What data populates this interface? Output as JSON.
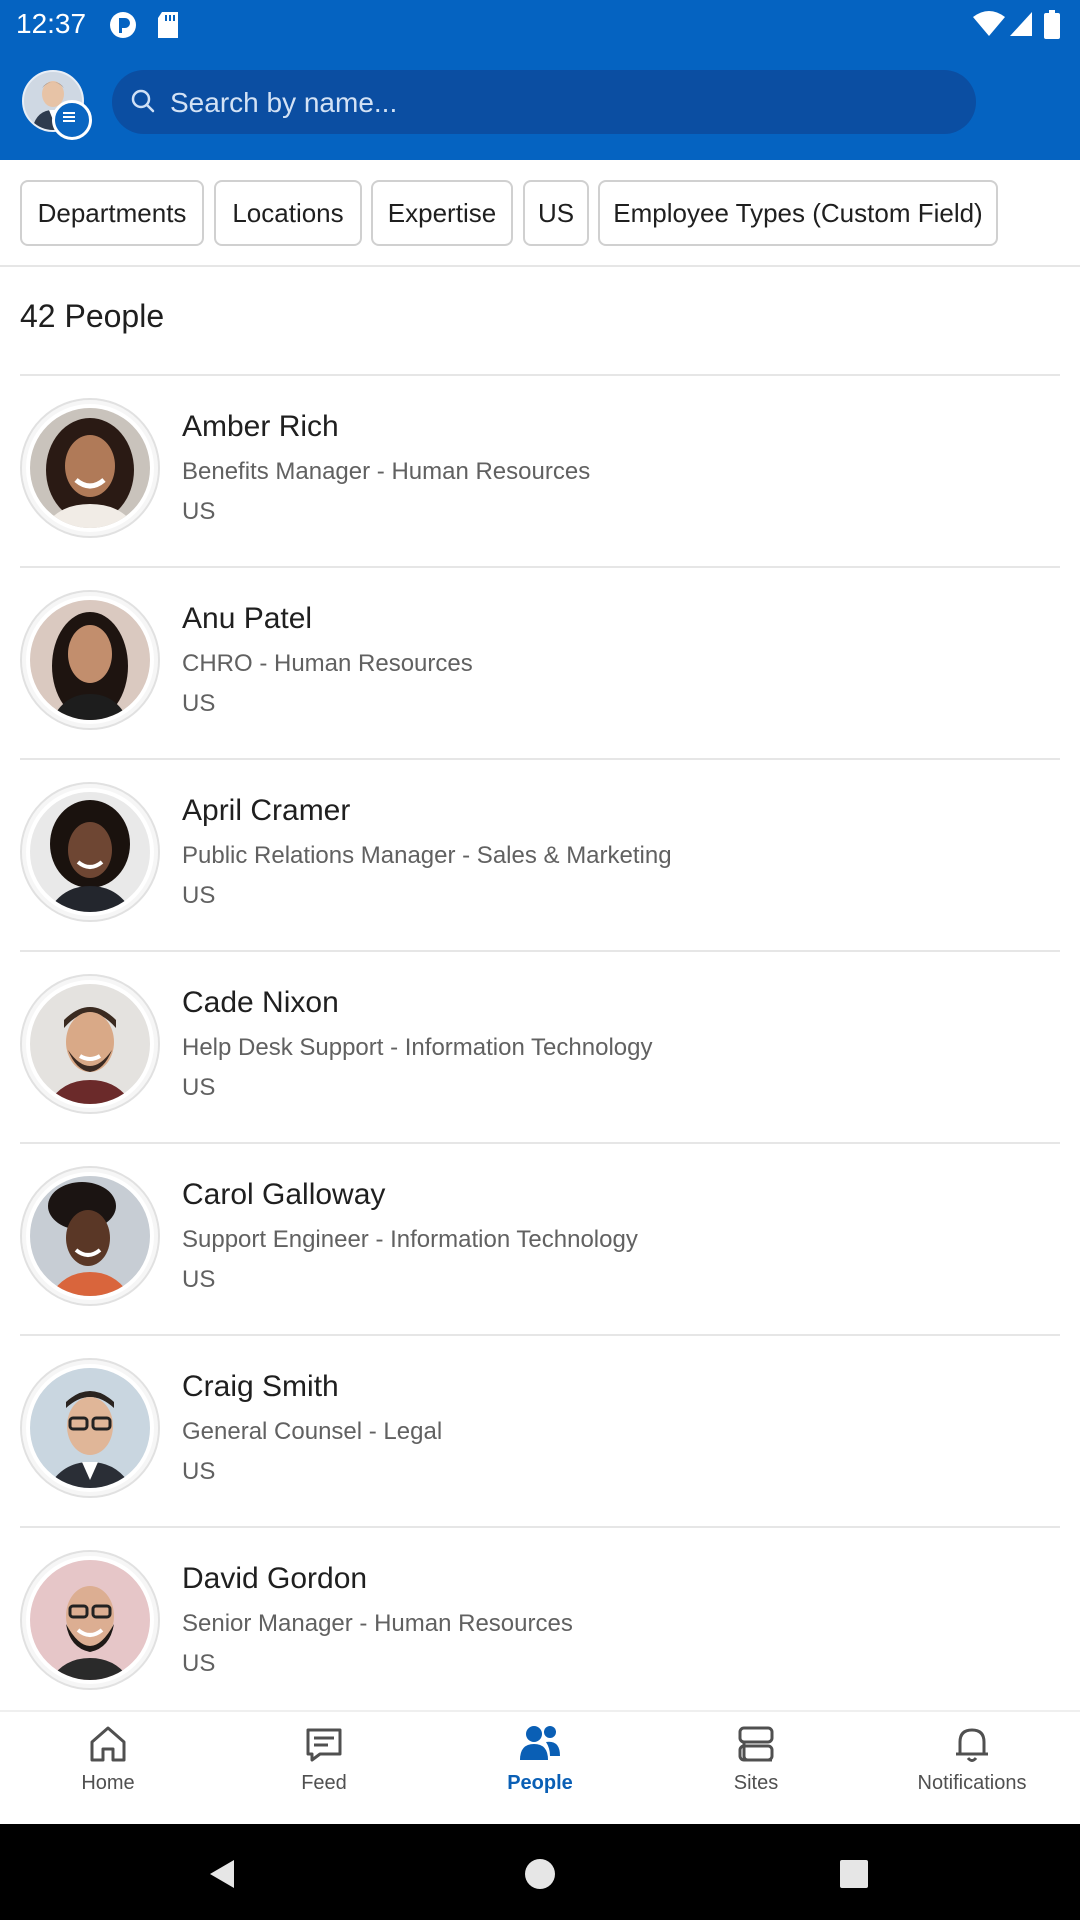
{
  "status_bar": {
    "time": "12:37",
    "icons": [
      "notification-p-icon",
      "sd-card-icon",
      "wifi-icon",
      "signal-icon",
      "battery-icon"
    ]
  },
  "header": {
    "search_placeholder": "Search by name..."
  },
  "filters": [
    "Departments",
    "Locations",
    "Expertise",
    "US",
    "Employee Types (Custom Field)"
  ],
  "people_count": "42 People",
  "people": [
    {
      "name": "Amber Rich",
      "role": "Benefits Manager - Human Resources",
      "location": "US"
    },
    {
      "name": "Anu Patel",
      "role": "CHRO - Human Resources",
      "location": "US"
    },
    {
      "name": "April Cramer",
      "role": "Public Relations Manager - Sales & Marketing",
      "location": "US"
    },
    {
      "name": "Cade Nixon",
      "role": "Help Desk Support - Information Technology",
      "location": "US"
    },
    {
      "name": "Carol Galloway",
      "role": "Support Engineer - Information Technology",
      "location": "US"
    },
    {
      "name": "Craig Smith",
      "role": "General Counsel - Legal",
      "location": "US"
    },
    {
      "name": "David Gordon",
      "role": "Senior Manager - Human Resources",
      "location": "US"
    }
  ],
  "bottom_nav": [
    {
      "label": "Home",
      "icon": "home-icon"
    },
    {
      "label": "Feed",
      "icon": "feed-icon"
    },
    {
      "label": "People",
      "icon": "people-icon",
      "active": true
    },
    {
      "label": "Sites",
      "icon": "sites-icon"
    },
    {
      "label": "Notifications",
      "icon": "bell-icon"
    }
  ],
  "colors": {
    "brand": "#0563c1",
    "search_bg": "#0b4ea2",
    "active_nav": "#0a5fb5"
  }
}
